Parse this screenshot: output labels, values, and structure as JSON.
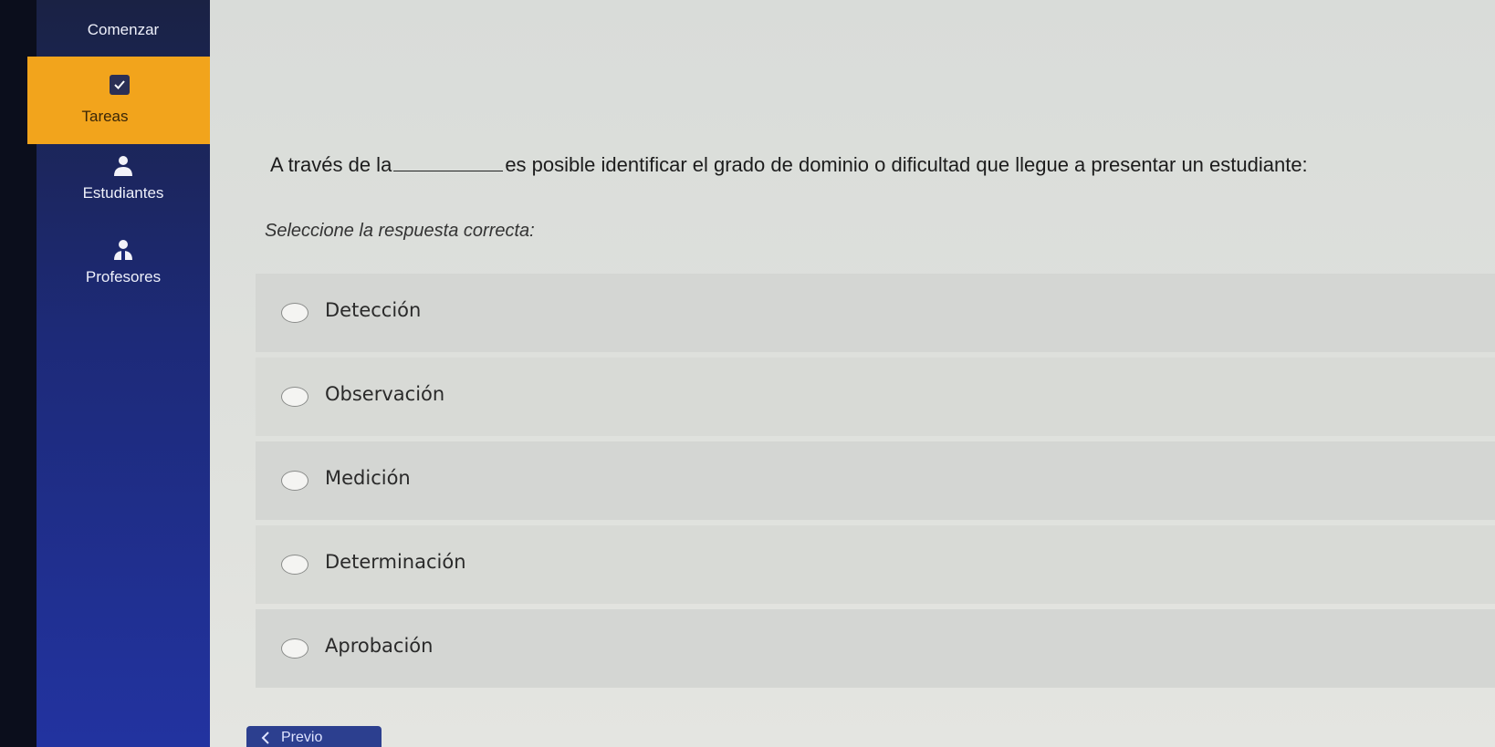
{
  "sidebar": {
    "start_label": "Comenzar",
    "tasks_label": "Tareas",
    "students_label": "Estudiantes",
    "teachers_label": "Profesores"
  },
  "question": {
    "part1": "A través de la",
    "part2": "es posible identificar el grado de dominio o dificultad que llegue a presentar un estudiante:",
    "instruction": "Seleccione la respuesta correcta:"
  },
  "options": [
    {
      "label": "Detección"
    },
    {
      "label": "Observación"
    },
    {
      "label": "Medición"
    },
    {
      "label": "Determinación"
    },
    {
      "label": "Aprobación"
    }
  ],
  "footer": {
    "prev_label": "Previo"
  },
  "colors": {
    "sidebar": "#1d2a78",
    "active_item": "#f2a41c",
    "content_bg": "#dcdeda"
  }
}
